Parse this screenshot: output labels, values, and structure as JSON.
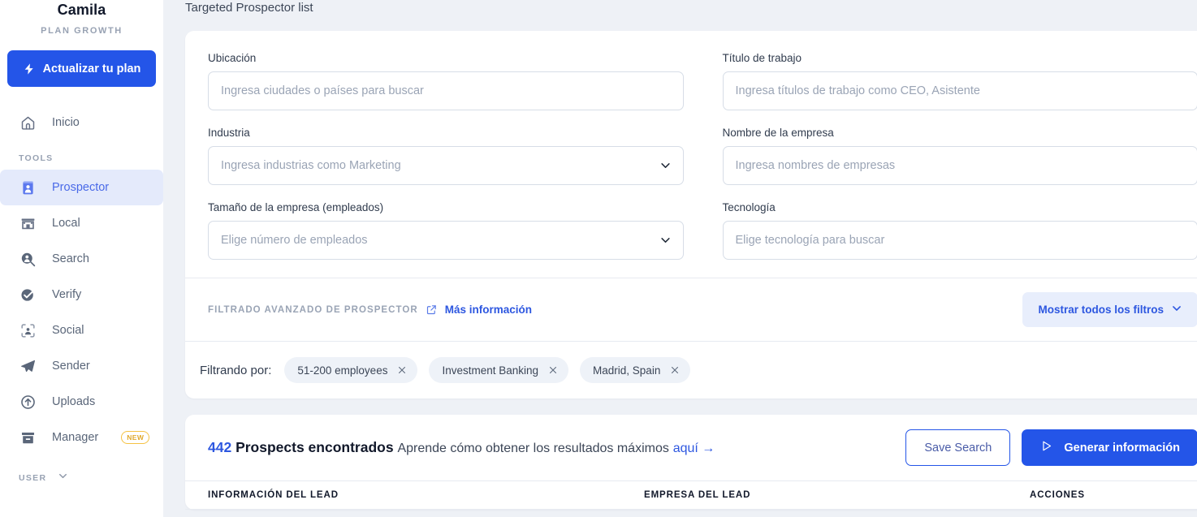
{
  "sidebar": {
    "brand_name": "Camila",
    "brand_plan": "PLAN GROWTH",
    "upgrade_label": "Actualizar tu plan",
    "home_label": "Inicio",
    "tools_section": "TOOLS",
    "items": [
      {
        "label": "Prospector",
        "icon": "id-card-icon",
        "active": true
      },
      {
        "label": "Local",
        "icon": "storefront-icon",
        "active": false
      },
      {
        "label": "Search",
        "icon": "person-search-icon",
        "active": false
      },
      {
        "label": "Verify",
        "icon": "check-badge-icon",
        "active": false
      },
      {
        "label": "Social",
        "icon": "face-scan-icon",
        "active": false
      },
      {
        "label": "Sender",
        "icon": "paper-plane-icon",
        "active": false
      },
      {
        "label": "Uploads",
        "icon": "upload-circle-icon",
        "active": false
      },
      {
        "label": "Manager",
        "icon": "archive-box-icon",
        "active": false,
        "badge": "NEW"
      }
    ],
    "user_section": "USER"
  },
  "page": {
    "title": "Targeted Prospector list"
  },
  "filters": {
    "ubicacion": {
      "label": "Ubicación",
      "placeholder": "Ingresa ciudades o países para buscar",
      "value": ""
    },
    "titulo": {
      "label": "Título de trabajo",
      "placeholder": "Ingresa títulos de trabajo como CEO, Asistente",
      "value": ""
    },
    "industria": {
      "label": "Industria",
      "placeholder": "Ingresa industrias como Marketing",
      "value": ""
    },
    "empresa": {
      "label": "Nombre de la empresa",
      "placeholder": "Ingresa nombres de empresas",
      "value": ""
    },
    "tamano": {
      "label": "Tamaño de la empresa (empleados)",
      "placeholder": "Elige número de empleados",
      "value": ""
    },
    "tecnologia": {
      "label": "Tecnología",
      "placeholder": "Elige tecnología para buscar",
      "value": ""
    }
  },
  "advanced": {
    "label": "FILTRADO AVANZADO DE PROSPECTOR",
    "link": "Más información",
    "show_all_label": "Mostrar todos los filtros"
  },
  "filtering": {
    "label": "Filtrando por:",
    "chips": [
      {
        "label": "51-200 employees"
      },
      {
        "label": "Investment Banking"
      },
      {
        "label": "Madrid, Spain"
      }
    ]
  },
  "results": {
    "count": "442",
    "count_label": "Prospects encontrados",
    "hint": "Aprende cómo obtener los resultados máximos",
    "hint_link": "aquí",
    "save_label": "Save Search",
    "generate_label": "Generar información",
    "columns": {
      "lead": "INFORMACIÓN DEL LEAD",
      "company": "EMPRESA DEL LEAD",
      "actions": "ACCIONES"
    }
  },
  "colors": {
    "accent": "#2455e8",
    "link": "#2d57e0",
    "page_bg": "#eef1f6",
    "active_nav_bg": "#e4eafb",
    "badge_new": "#f5c243"
  }
}
